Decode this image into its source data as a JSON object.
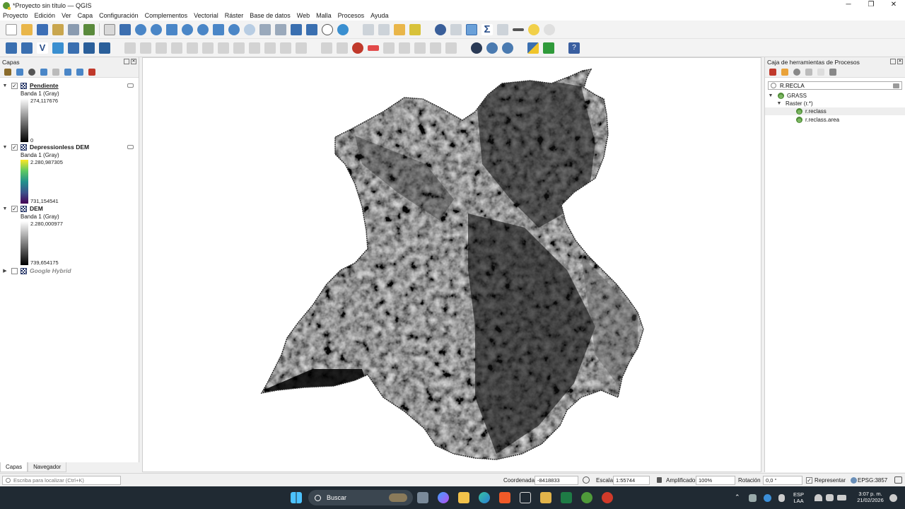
{
  "window": {
    "title": "*Proyecto sin título — QGIS",
    "controls": [
      "─",
      "❐",
      "✕"
    ]
  },
  "menu": [
    "Proyecto",
    "Edición",
    "Ver",
    "Capa",
    "Configuración",
    "Complementos",
    "Vectorial",
    "Ráster",
    "Base de datos",
    "Web",
    "Malla",
    "Procesos",
    "Ayuda"
  ],
  "layers_panel": {
    "title": "Capas",
    "layers": [
      {
        "name": "Pendiente",
        "band": "Banda 1 (Gray)",
        "max": "274,117676",
        "min": "0",
        "checked": true
      },
      {
        "name": "Depressionless DEM",
        "band": "Banda 1 (Gray)",
        "max": "2.280,987305",
        "min": "731,154541",
        "checked": true
      },
      {
        "name": "DEM",
        "band": "Banda 1 (Gray)",
        "max": "2.280,000977",
        "min": "739,654175",
        "checked": true
      },
      {
        "name": "Google Hybrid",
        "checked": false
      }
    ],
    "tabs": [
      "Capas",
      "Navegador"
    ]
  },
  "processing": {
    "title": "Caja de herramientas de Procesos",
    "search_value": "R.RECLA",
    "tree": {
      "provider": "GRASS",
      "group": "Raster (r.*)",
      "items": [
        "r.reclass",
        "r.reclass.area"
      ]
    }
  },
  "locator": {
    "placeholder": "Escriba para localizar (Ctrl+K)"
  },
  "status": {
    "coord_label": "Coordenada",
    "coord_value": "-8418833  678209",
    "scale_label": "Escala",
    "scale_value": "1:55744",
    "magnifier_label": "Amplificador",
    "magnifier_value": "100%",
    "rotation_label": "Rotación",
    "rotation_value": "0,0 °",
    "render_label": "Representar",
    "crs": "EPSG:3857"
  },
  "taskbar": {
    "search": "Buscar",
    "lang": "ESP",
    "lang2": "LAA",
    "time": "3:07 p. m.",
    "date": "21/02/2026"
  }
}
